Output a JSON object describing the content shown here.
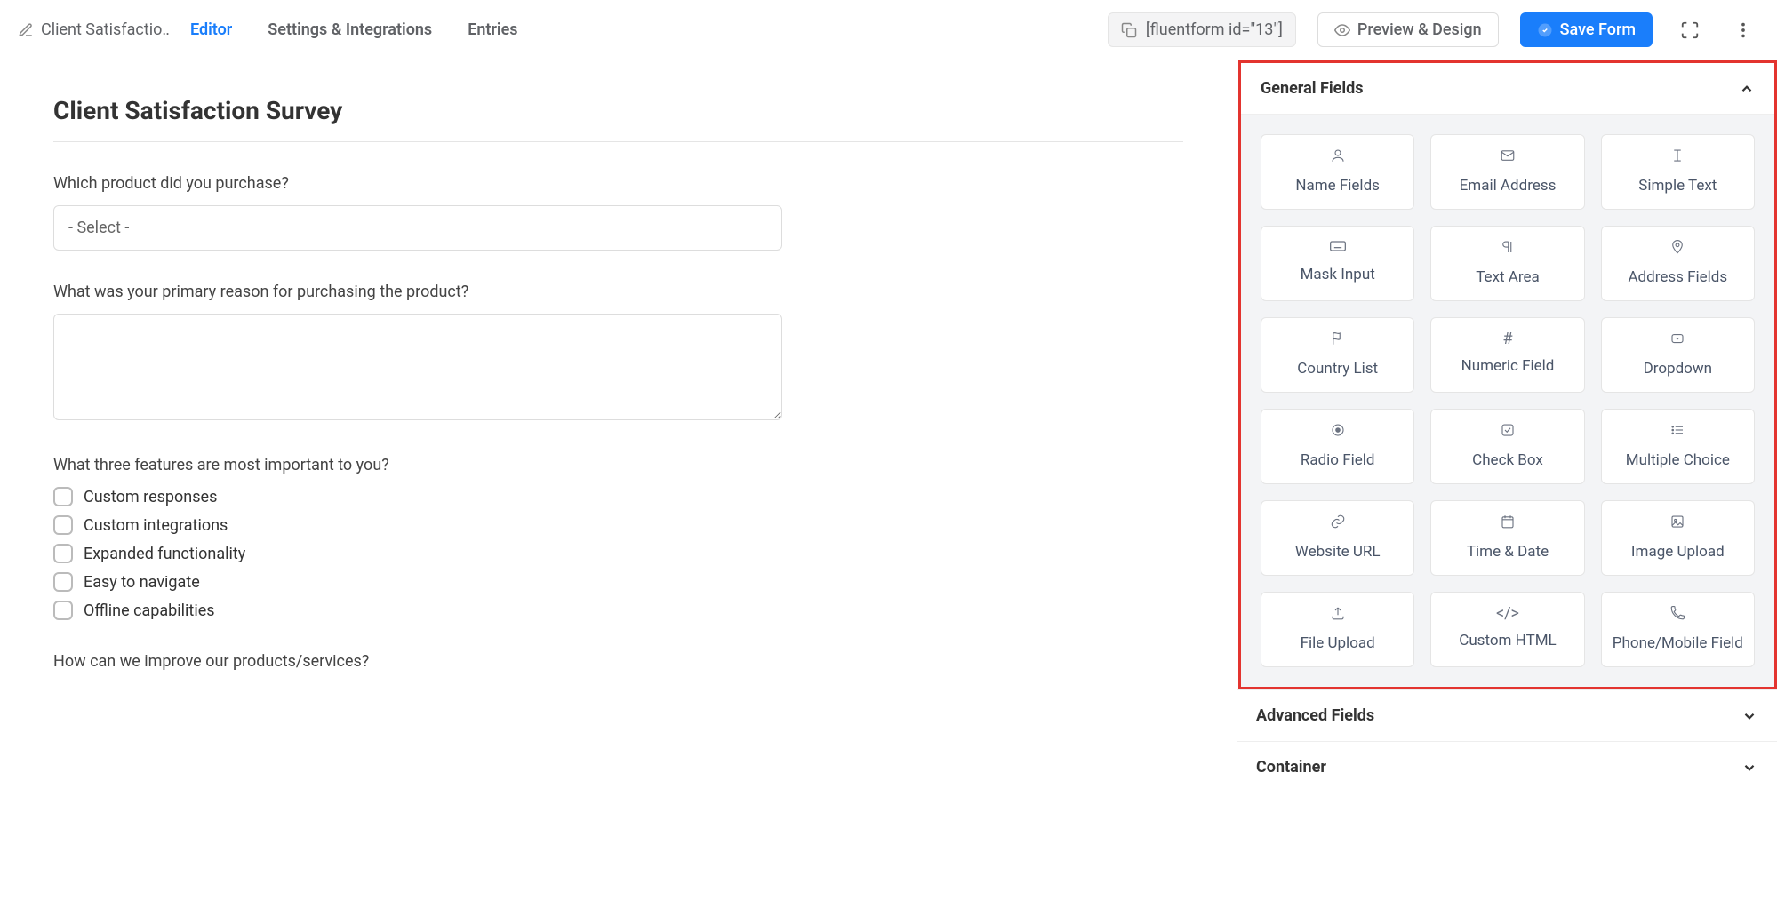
{
  "header": {
    "form_name": "Client Satisfactio…",
    "tabs": {
      "editor": "Editor",
      "settings": "Settings & Integrations",
      "entries": "Entries"
    },
    "shortcode": "[fluentform id=\"13\"]",
    "preview_label": "Preview & Design",
    "save_label": "Save Form"
  },
  "form": {
    "title": "Client Satisfaction Survey",
    "q1_label": "Which product did you purchase?",
    "q1_placeholder": "- Select -",
    "q2_label": "What was your primary reason for purchasing the product?",
    "q3_label": "What three features are most important to you?",
    "q3_options": [
      "Custom responses",
      "Custom integrations",
      "Expanded functionality",
      "Easy to navigate",
      "Offline capabilities"
    ],
    "q4_label": "How can we improve our products/services?"
  },
  "panel": {
    "general_title": "General Fields",
    "advanced_title": "Advanced Fields",
    "container_title": "Container",
    "fields": [
      {
        "label": "Name Fields",
        "icon": "user"
      },
      {
        "label": "Email Address",
        "icon": "mail"
      },
      {
        "label": "Simple Text",
        "icon": "textcursor"
      },
      {
        "label": "Mask Input",
        "icon": "keyboard"
      },
      {
        "label": "Text Area",
        "icon": "paragraph"
      },
      {
        "label": "Address Fields",
        "icon": "pin"
      },
      {
        "label": "Country List",
        "icon": "flag"
      },
      {
        "label": "Numeric Field",
        "icon": "hash"
      },
      {
        "label": "Dropdown",
        "icon": "dropdown"
      },
      {
        "label": "Radio Field",
        "icon": "radio"
      },
      {
        "label": "Check Box",
        "icon": "check"
      },
      {
        "label": "Multiple Choice",
        "icon": "list"
      },
      {
        "label": "Website URL",
        "icon": "link"
      },
      {
        "label": "Time & Date",
        "icon": "calendar"
      },
      {
        "label": "Image Upload",
        "icon": "image"
      },
      {
        "label": "File Upload",
        "icon": "upload"
      },
      {
        "label": "Custom HTML",
        "icon": "code"
      },
      {
        "label": "Phone/Mobile Field",
        "icon": "phone"
      }
    ]
  }
}
